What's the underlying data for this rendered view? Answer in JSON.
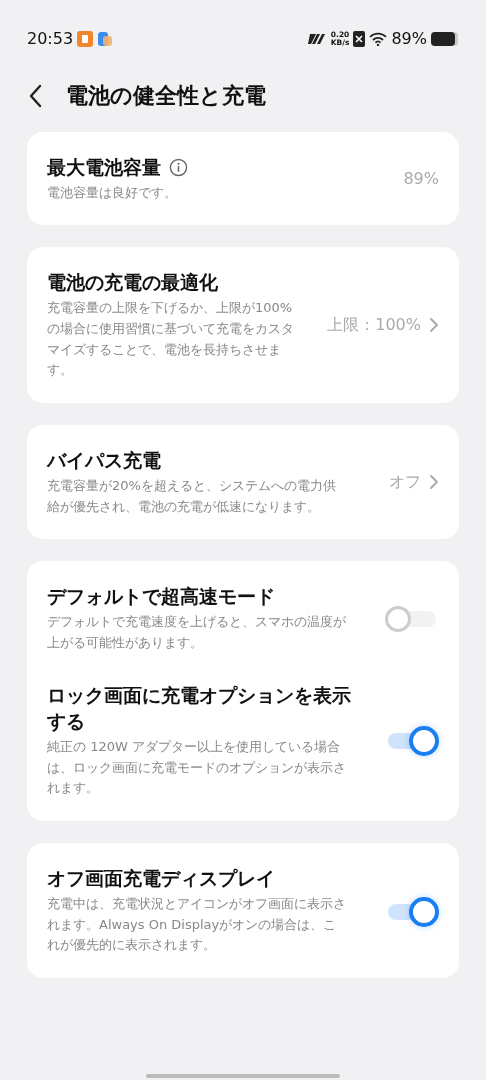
{
  "status_bar": {
    "time": "20:53",
    "speed_value": "0.20",
    "speed_unit": "KB/s",
    "battery": "89%"
  },
  "header": {
    "title": "電池の健全性と充電"
  },
  "groups": [
    {
      "items": [
        {
          "kind": "value",
          "title": "最大電池容量",
          "info_icon": true,
          "description": "電池容量は良好です。",
          "value": "89%"
        }
      ]
    },
    {
      "items": [
        {
          "kind": "link",
          "title": "電池の充電の最適化",
          "description": "充電容量の上限を下げるか、上限が100% の場合に使用習慣に基づいて充電をカスタマイズすることで、電池を長持ちさせます。",
          "value": "上限：100%"
        }
      ]
    },
    {
      "items": [
        {
          "kind": "link",
          "title": "バイパス充電",
          "description": "充電容量が20%を超えると、システムへの電力供給が優先され、電池の充電が低速になります。",
          "value": "オフ"
        }
      ]
    },
    {
      "items": [
        {
          "kind": "toggle",
          "title": "デフォルトで超高速モード",
          "description": "デフォルトで充電速度を上げると、スマホの温度が上がる可能性があります。",
          "on": false
        },
        {
          "kind": "toggle",
          "title": "ロック画面に充電オプションを表示する",
          "description": "純正の 120W アダプター以上を使用している場合は、ロック画面に充電モードのオプションが表示されます。",
          "on": true
        }
      ]
    },
    {
      "items": [
        {
          "kind": "toggle",
          "title": "オフ画面充電ディスプレイ",
          "description": "充電中は、充電状況とアイコンがオフ画面に表示されます。Always On Displayがオンの場合は、これが優先的に表示されます。",
          "on": true
        }
      ]
    }
  ]
}
